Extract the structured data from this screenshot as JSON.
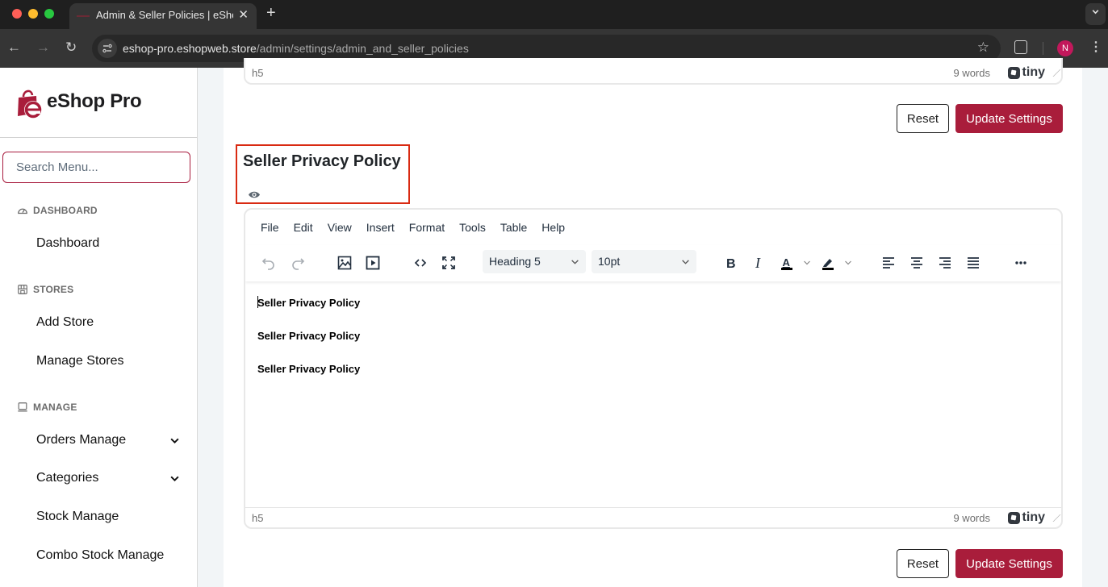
{
  "browser": {
    "tab_title": "Admin & Seller Policies | eShop Pro",
    "tab_close": "✕",
    "new_tab": "+",
    "tab_dropdown": "⌄",
    "url_host": "eshop-pro.eshopweb.store",
    "url_path": "/admin/settings/admin_and_seller_policies",
    "back": "←",
    "forward": "→",
    "reload": "↻",
    "site_info": "⚙",
    "bookmark": "☆",
    "profile_initial": "N",
    "menu": "⋮",
    "colors": {
      "profile": "#c2185b"
    }
  },
  "sidebar": {
    "brand_name": "eShop Pro",
    "search_placeholder": "Search Menu...",
    "sections": [
      {
        "label": "DASHBOARD",
        "icon": "gauge-icon",
        "items": [
          {
            "label": "Dashboard"
          }
        ]
      },
      {
        "label": "STORES",
        "icon": "store-icon",
        "items": [
          {
            "label": "Add Store"
          },
          {
            "label": "Manage Stores"
          }
        ]
      },
      {
        "label": "MANAGE",
        "icon": "laptop-icon",
        "items": [
          {
            "label": "Orders Manage",
            "expandable": true
          },
          {
            "label": "Categories",
            "expandable": true
          },
          {
            "label": "Stock Manage"
          },
          {
            "label": "Combo Stock Manage"
          }
        ]
      }
    ]
  },
  "top_editor": {
    "path": "h5",
    "word_count": "9 words",
    "brand": "tiny"
  },
  "actions": {
    "reset_label": "Reset",
    "update_label": "Update Settings"
  },
  "seller_section": {
    "title": "Seller Privacy Policy",
    "preview_icon": "eye-icon",
    "editor": {
      "menus": [
        "File",
        "Edit",
        "View",
        "Insert",
        "Format",
        "Tools",
        "Table",
        "Help"
      ],
      "block_format": "Heading 5",
      "font_size": "10pt",
      "content": [
        "Seller Privacy Policy",
        "Seller Privacy Policy",
        "Seller Privacy Policy"
      ],
      "path": "h5",
      "word_count": "9 words",
      "brand": "tiny"
    }
  },
  "theme": {
    "accent": "#a91d3b",
    "highlight_box": "#d92a12",
    "page_bg": "#f2f5f7"
  }
}
